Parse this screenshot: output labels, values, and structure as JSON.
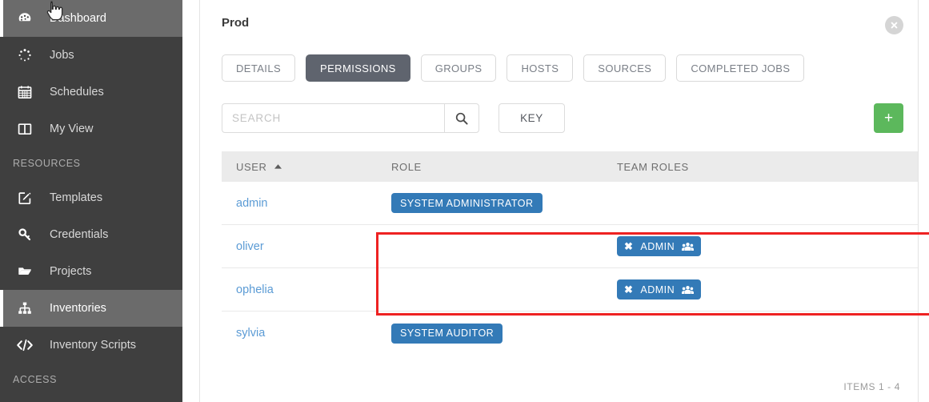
{
  "sidebar": {
    "items": [
      {
        "label": "Dashboard",
        "icon": "dashboard-icon",
        "active": true,
        "type": "item"
      },
      {
        "label": "Jobs",
        "icon": "jobs-spinner-icon",
        "active": false,
        "type": "item"
      },
      {
        "label": "Schedules",
        "icon": "calendar-icon",
        "active": false,
        "type": "item"
      },
      {
        "label": "My View",
        "icon": "columns-icon",
        "active": false,
        "type": "item"
      },
      {
        "label": "RESOURCES",
        "type": "section"
      },
      {
        "label": "Templates",
        "icon": "edit-square-icon",
        "active": false,
        "type": "item"
      },
      {
        "label": "Credentials",
        "icon": "key-icon",
        "active": false,
        "type": "item"
      },
      {
        "label": "Projects",
        "icon": "folder-icon",
        "active": false,
        "type": "item"
      },
      {
        "label": "Inventories",
        "icon": "sitemap-icon",
        "active": true,
        "type": "item"
      },
      {
        "label": "Inventory Scripts",
        "icon": "code-icon",
        "active": false,
        "type": "item"
      },
      {
        "label": "ACCESS",
        "type": "section"
      }
    ]
  },
  "panel": {
    "title": "Prod",
    "close_label": "close-icon",
    "tabs": [
      {
        "label": "DETAILS",
        "active": false
      },
      {
        "label": "PERMISSIONS",
        "active": true
      },
      {
        "label": "GROUPS",
        "active": false
      },
      {
        "label": "HOSTS",
        "active": false
      },
      {
        "label": "SOURCES",
        "active": false
      },
      {
        "label": "COMPLETED JOBS",
        "active": false
      }
    ],
    "search": {
      "value": "",
      "placeholder": "SEARCH",
      "submit_icon": "search-icon"
    },
    "key_button": "KEY",
    "add_button": "+",
    "table": {
      "columns": [
        "USER",
        "ROLE",
        "TEAM ROLES"
      ],
      "sort_column": "USER",
      "sort_direction": "asc",
      "rows": [
        {
          "user": "admin",
          "role": "SYSTEM ADMINISTRATOR",
          "team_role": ""
        },
        {
          "user": "oliver",
          "role": "",
          "team_role": "ADMIN"
        },
        {
          "user": "ophelia",
          "role": "",
          "team_role": "ADMIN"
        },
        {
          "user": "sylvia",
          "role": "SYSTEM AUDITOR",
          "team_role": ""
        }
      ]
    },
    "footer": "ITEMS  1 - 4"
  },
  "annotation": {
    "highlight_color": "#ee2222",
    "highlighted_rows": [
      "oliver",
      "ophelia"
    ]
  },
  "colors": {
    "sidebar_bg": "#3f3f3f",
    "sidebar_active": "#6b6b6b",
    "tab_active_bg": "#5f646e",
    "badge_blue": "#337ab7",
    "add_green": "#5cb85c",
    "link_blue": "#5b9bd5",
    "header_gray": "#ebebeb"
  }
}
